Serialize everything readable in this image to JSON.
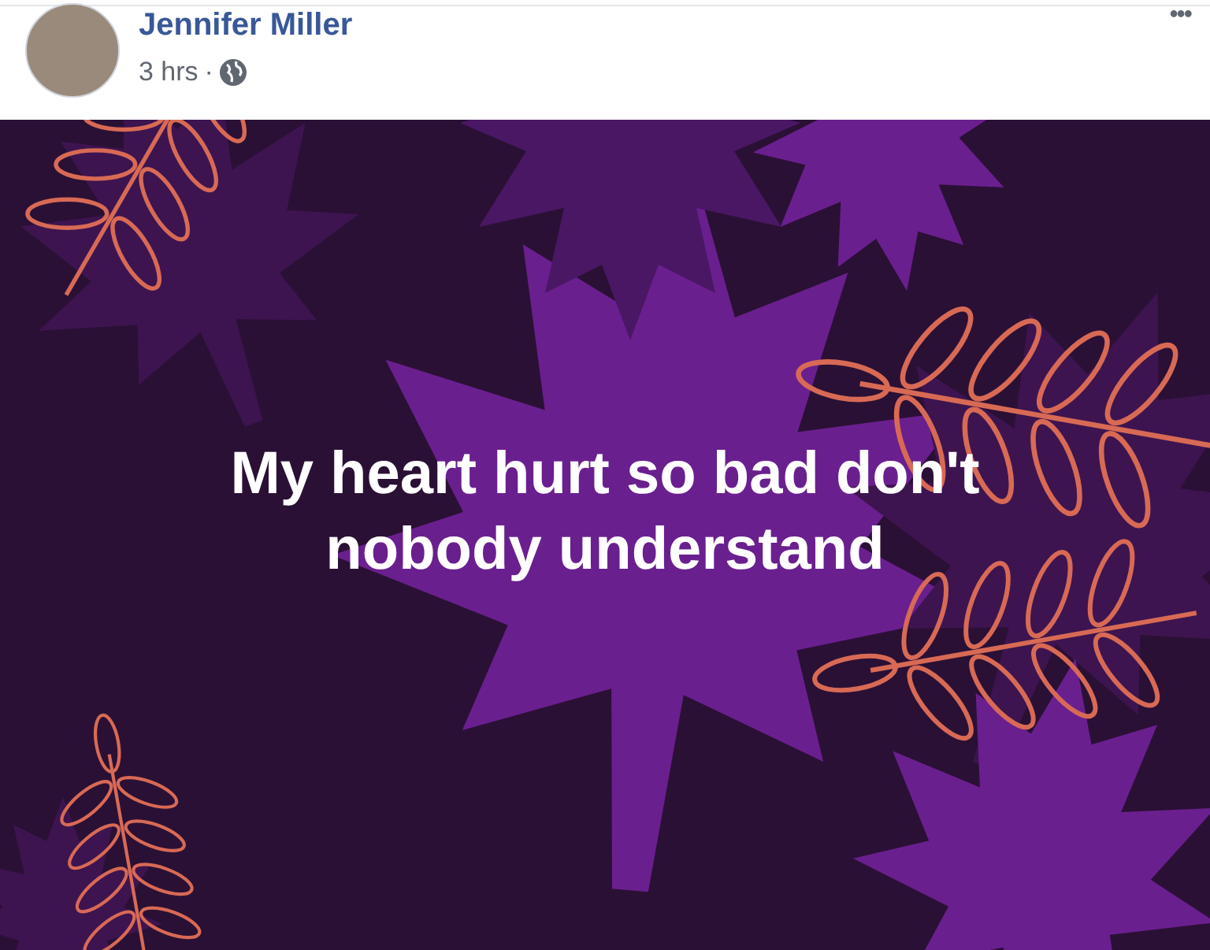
{
  "post": {
    "author": "Jennifer Miller",
    "time": "3 hrs",
    "separator": "·",
    "menu": "•••"
  },
  "status_text": "My heart hurt so bad don't nobody understand"
}
